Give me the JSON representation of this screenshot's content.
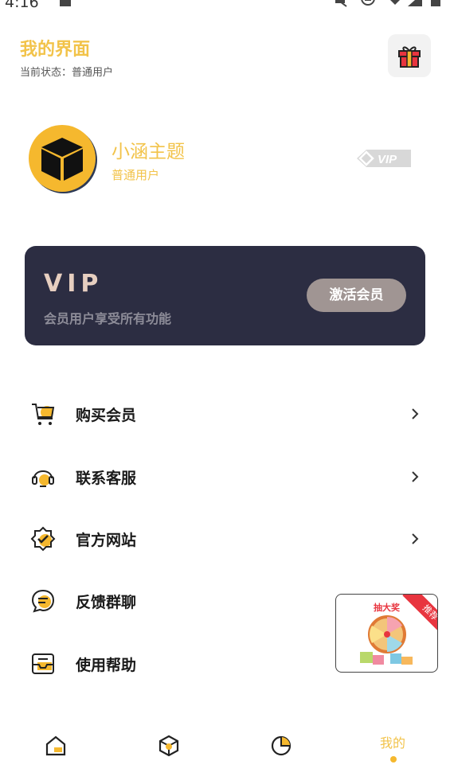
{
  "status_bar": {
    "time": "4:16"
  },
  "header": {
    "title": "我的界面",
    "subtitle": "当前状态：普通用户"
  },
  "profile": {
    "name": "小涵主题",
    "level": "普通用户",
    "badge": "VIP"
  },
  "vip_card": {
    "title": "VIP",
    "description": "会员用户享受所有功能",
    "button_label": "激活会员"
  },
  "menu": {
    "items": [
      {
        "label": "购买会员",
        "icon": "cart-icon"
      },
      {
        "label": "联系客服",
        "icon": "customer-service-icon"
      },
      {
        "label": "官方网站",
        "icon": "badge-check-icon"
      },
      {
        "label": "反馈群聊",
        "icon": "chat-bubble-icon"
      },
      {
        "label": "使用帮助",
        "icon": "inbox-help-icon"
      }
    ]
  },
  "promo": {
    "title": "抽大奖",
    "ribbon": "推荐"
  },
  "nav": {
    "items": [
      {
        "icon": "home-icon"
      },
      {
        "icon": "cube-icon"
      },
      {
        "icon": "pie-chart-icon"
      },
      {
        "label": "我的"
      }
    ]
  },
  "colors": {
    "accent": "#f2c34a",
    "card_bg": "#2c2d42",
    "ribbon": "#e8353f"
  }
}
